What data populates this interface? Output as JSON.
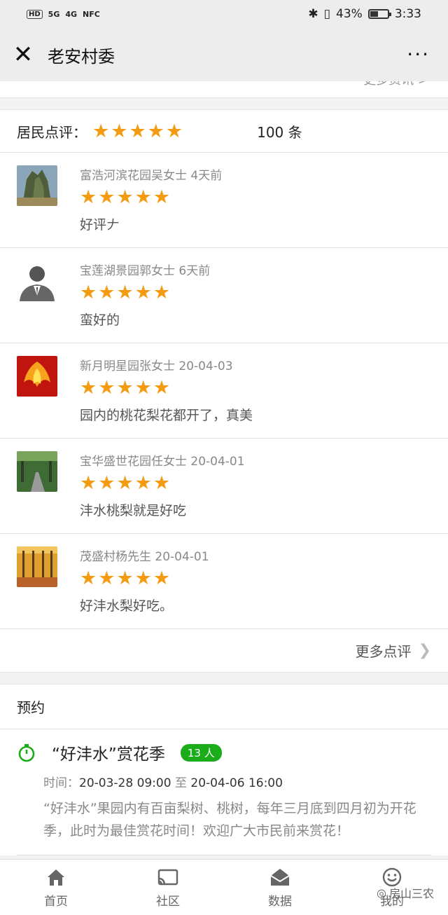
{
  "status_bar": {
    "left_icons": [
      "HD",
      "5G",
      "4G",
      "NFC"
    ],
    "battery": "43%",
    "time": "3:33",
    "battery_level": 0.43
  },
  "nav": {
    "title": "老安村委",
    "more": "···"
  },
  "cut_text": "更多资讯 >",
  "reviews": {
    "label": "居民点评：",
    "rating": 5,
    "count": "100 条",
    "items": [
      {
        "meta": "富浩河滨花园吴女士 4天前",
        "rating": 5,
        "text": "好评𠂇",
        "avatar": "mountain-photo"
      },
      {
        "meta": "宝莲湖景园郭女士 6天前",
        "rating": 5,
        "text": "蛮好的",
        "avatar": "default-person"
      },
      {
        "meta": "新月明星园张女士 20-04-03",
        "rating": 5,
        "text": "园内的桃花梨花都开了，真美",
        "avatar": "phoenix"
      },
      {
        "meta": "宝华盛世花园任女士 20-04-01",
        "rating": 5,
        "text": "沣水桃梨就是好吃",
        "avatar": "tree-road"
      },
      {
        "meta": "茂盛村杨先生 20-04-01",
        "rating": 5,
        "text": "好沣水梨好吃。",
        "avatar": "autumn-trees"
      }
    ],
    "more_label": "更多点评"
  },
  "appointment": {
    "heading": "预约",
    "event": {
      "name": "“好沣水”赏花季",
      "badge": "13 人",
      "time_label": "时间：",
      "start": "20-03-28 09:00",
      "to": "至",
      "end": "20-04-06 16:00",
      "description": "“好沣水”果园内有百亩梨树、桃树，每年三月底到四月初为开花季，此时为最佳赏花时间！欢迎广大市民前来赏花！"
    }
  },
  "tabs": [
    {
      "label": "首页",
      "icon": "home-icon"
    },
    {
      "label": "社区",
      "icon": "cast-icon"
    },
    {
      "label": "数据",
      "icon": "mail-icon"
    },
    {
      "label": "我的",
      "icon": "smile-icon"
    }
  ],
  "watermark": "房山三农",
  "colors": {
    "star": "#f39c12",
    "green": "#1aad19",
    "timer": "#1aad19"
  }
}
